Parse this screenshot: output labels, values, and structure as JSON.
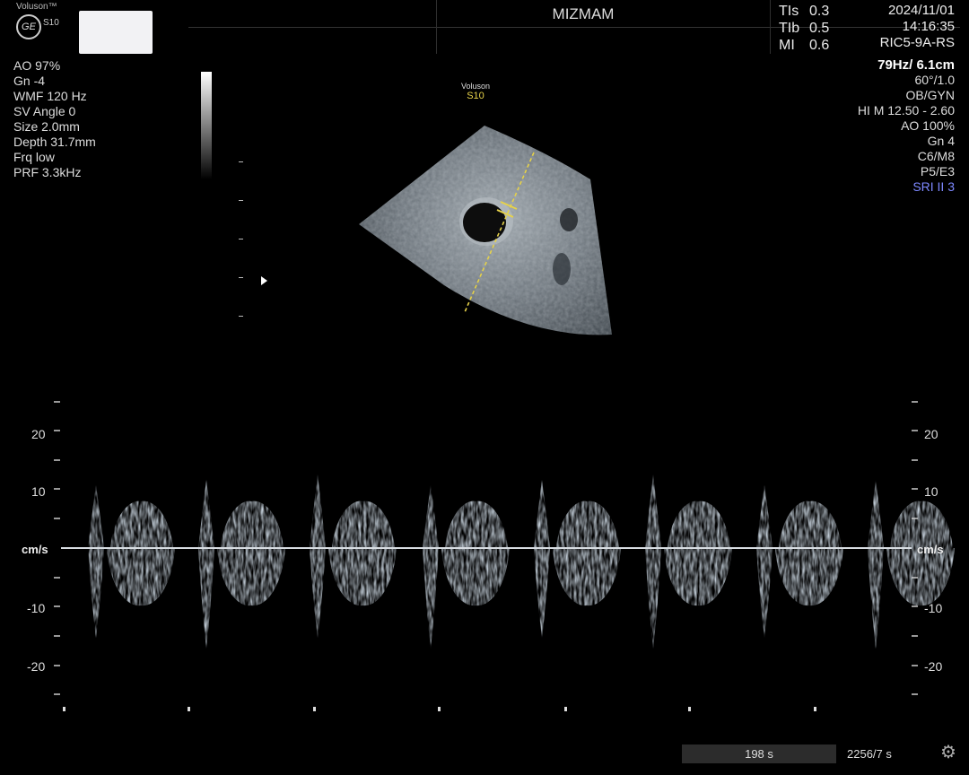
{
  "branding": {
    "product": "Voluson™",
    "logo": "GE",
    "model": "S10"
  },
  "header": {
    "title": "MIZMAM",
    "date": "2024/11/01",
    "time": "14:16:35"
  },
  "indices": [
    {
      "label": "TIs",
      "value": "0.3"
    },
    {
      "label": "TIb",
      "value": "0.5"
    },
    {
      "label": "MI",
      "value": "0.6"
    }
  ],
  "probe": {
    "name": "RIC5-9A-RS",
    "frame": "79Hz/ 6.1cm"
  },
  "left_params": [
    "AO 97%",
    "Gn  -4",
    "WMF 120 Hz",
    "SV Angle  0",
    "Size  2.0mm",
    "Depth 31.7mm",
    "Frq low",
    "PRF  3.3kHz"
  ],
  "right_params": [
    "60°/1.0",
    "OB/GYN",
    "HI M  12.50 - 2.60",
    "AO 100%",
    "Gn  4",
    "C6/M8",
    "P5/E3"
  ],
  "sri": "SRI II 3",
  "image_label": {
    "line1": "Voluson",
    "line2": "S10"
  },
  "doppler": {
    "unit": "cm/s",
    "left_ticks": [
      "20",
      "10",
      "-10",
      "-20"
    ],
    "right_ticks": [
      "20",
      "10",
      "-10",
      "-20"
    ]
  },
  "status": {
    "elapsed": "198 s",
    "frames": "2256/7 s"
  },
  "icons": {
    "settings": "gear-icon",
    "marker": "triangle-right-icon"
  },
  "colors": {
    "background": "#000000",
    "spectrum": "#b9d0e6",
    "sri": "#7d88ff",
    "cursor": "#e6d24a"
  }
}
